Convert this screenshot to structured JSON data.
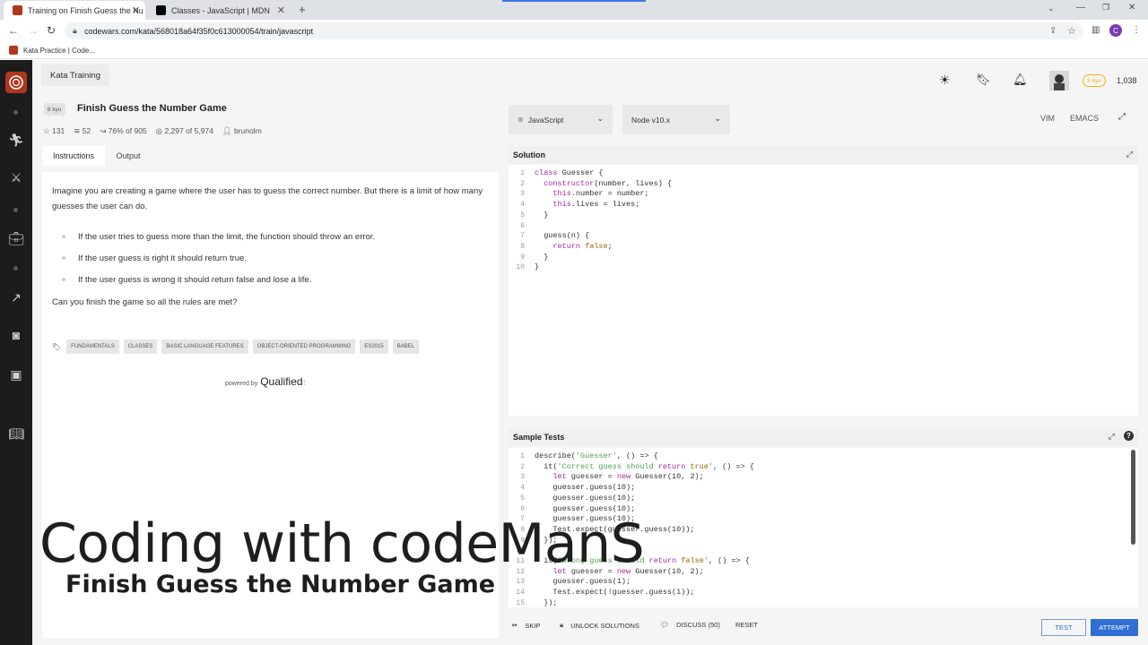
{
  "browser": {
    "tabs": [
      {
        "title": "Training on Finish Guess the Nu",
        "active": true
      },
      {
        "title": "Classes - JavaScript | MDN",
        "active": false
      }
    ],
    "url": "codewars.com/kata/568018a64f35f0c613000054/train/javascript",
    "bookmark": "Kata Practice | Code...",
    "profile_initial": "C"
  },
  "header": {
    "section": "Kata Training",
    "rank_value": "5 kyu",
    "honor": "1,038"
  },
  "kata": {
    "kyu": "8 kyu",
    "title": "Finish Guess the Number Game",
    "stars": "131",
    "collections": "52",
    "satisfaction": "76% of 905",
    "completions": "2,297 of 5,974",
    "author": "brunolm"
  },
  "desc_tabs": {
    "instructions": "Instructions",
    "output": "Output"
  },
  "description": {
    "intro": "Imagine you are creating a game where the user has to guess the correct number. But there is a limit of how many guesses the user can do.",
    "rules": [
      "If the user tries to guess more than the limit, the function should throw an error.",
      "If the user guess is right it should return true.",
      "If the user guess is wrong it should return false and lose a life."
    ],
    "outro": "Can you finish the game so all the rules are met?"
  },
  "tags": [
    "FUNDAMENTALS",
    "CLASSES",
    "BASIC LANGUAGE FEATURES",
    "OBJECT-ORIENTED PROGRAMMING",
    "ES2015",
    "BABEL"
  ],
  "powered": {
    "prefix": "powered by",
    "brand": "Qualified"
  },
  "editor": {
    "language": "JavaScript",
    "runtime": "Node v10.x",
    "mode_vim": "VIM",
    "mode_emacs": "EMACS"
  },
  "solution": {
    "title": "Solution",
    "lines": [
      "class Guesser {",
      "  constructor(number, lives) {",
      "    this.number = number;",
      "    this.lives = lives;",
      "  }",
      "",
      "  guess(n) {",
      "    return false;",
      "  }",
      "}"
    ]
  },
  "sample_tests": {
    "title": "Sample Tests",
    "lines": [
      "describe('Guesser', () => {",
      "  it('Correct guess should return true', () => {",
      "    let guesser = new Guesser(10, 2);",
      "    guesser.guess(10);",
      "    guesser.guess(10);",
      "    guesser.guess(10);",
      "    guesser.guess(10);",
      "    Test.expect(guesser.guess(10));",
      "  });",
      "",
      "  it('Wrong guess should return false', () => {",
      "    let guesser = new Guesser(10, 2);",
      "    guesser.guess(1);",
      "    Test.expect(!guesser.guess(1));",
      "  });"
    ]
  },
  "footer": {
    "skip": "SKIP",
    "unlock": "UNLOCK SOLUTIONS",
    "discuss": "DISCUSS (50)",
    "reset": "RESET",
    "test": "TEST",
    "attempt": "ATTEMPT"
  },
  "overlay": {
    "title": "Coding with codeManS",
    "subtitle": "Finish Guess the Number Game"
  },
  "colors": {
    "sidebar": "#1c1c1c",
    "accent_red": "#b1361e",
    "attempt_blue": "#2d6fd3",
    "rank_gold": "#ecb613",
    "keyword": "#a626a4",
    "string": "#50a14f"
  }
}
